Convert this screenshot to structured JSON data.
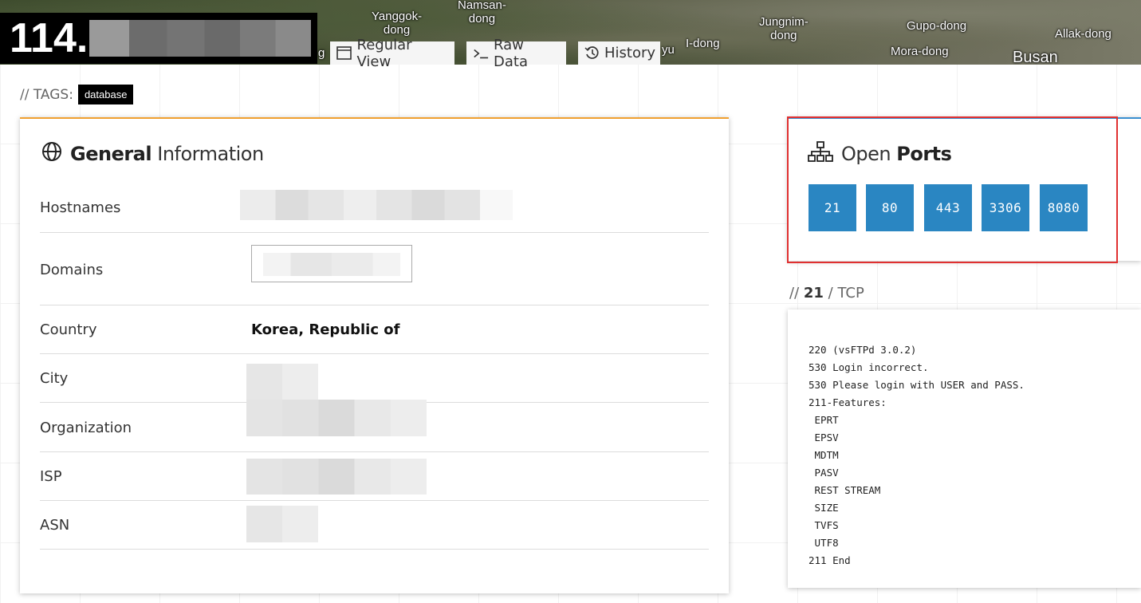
{
  "header": {
    "ip_prefix": "114.",
    "map_labels": [
      {
        "text": "Yanggok-\ndong"
      },
      {
        "text": "Namsan-\ndong"
      },
      {
        "text": "Jungnim-\ndong"
      },
      {
        "text": "Gupo-dong"
      },
      {
        "text": "Allak-dong"
      },
      {
        "text": "I-dong"
      },
      {
        "text": "Mora-dong"
      },
      {
        "text": "Busan"
      },
      {
        "text": "yu"
      },
      {
        "text": "g"
      }
    ],
    "tabs": [
      {
        "label": "Regular View",
        "icon": "window-icon"
      },
      {
        "label": "Raw Data",
        "icon": "terminal-icon"
      },
      {
        "label": "History",
        "icon": "history-icon"
      }
    ]
  },
  "tags": {
    "label": "// TAGS:",
    "items": [
      "database"
    ]
  },
  "general": {
    "title_bold": "General",
    "title_light": "Information",
    "icon": "globe-icon",
    "rows": [
      {
        "label": "Hostnames",
        "value": ""
      },
      {
        "label": "Domains",
        "value": ""
      },
      {
        "label": "Country",
        "value": "Korea, Republic of"
      },
      {
        "label": "City",
        "value": ""
      },
      {
        "label": "Organization",
        "value": ""
      },
      {
        "label": "ISP",
        "value": ""
      },
      {
        "label": "ASN",
        "value": ""
      }
    ]
  },
  "ports": {
    "title_light": "Open",
    "title_bold": "Ports",
    "icon": "network-icon",
    "list": [
      "21",
      "80",
      "443",
      "3306",
      "8080"
    ]
  },
  "service": {
    "slashes": "//",
    "port": "21",
    "proto": "/ TCP",
    "banner": "220 (vsFTPd 3.0.2)\n530 Login incorrect.\n530 Please login with USER and PASS.\n211-Features:\n EPRT\n EPSV\n MDTM\n PASV\n REST STREAM\n SIZE\n TVFS\n UTF8\n211 End"
  },
  "colors": {
    "accent_orange": "#f0a030",
    "accent_blue": "#3a8fd0",
    "port_button": "#2a86c2",
    "highlight_red": "#e03030"
  }
}
